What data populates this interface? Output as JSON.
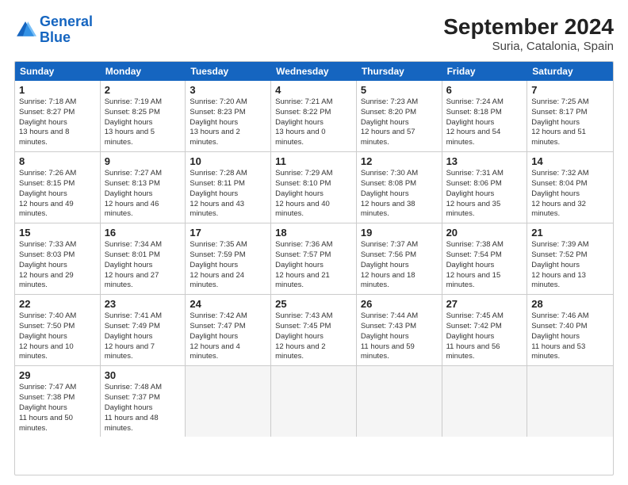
{
  "logo": {
    "text_general": "General",
    "text_blue": "Blue"
  },
  "header": {
    "title": "September 2024",
    "subtitle": "Suria, Catalonia, Spain"
  },
  "days_of_week": [
    "Sunday",
    "Monday",
    "Tuesday",
    "Wednesday",
    "Thursday",
    "Friday",
    "Saturday"
  ],
  "weeks": [
    [
      {
        "day": 1,
        "sunrise": "7:18 AM",
        "sunset": "8:27 PM",
        "daylight": "13 hours and 8 minutes."
      },
      {
        "day": 2,
        "sunrise": "7:19 AM",
        "sunset": "8:25 PM",
        "daylight": "13 hours and 5 minutes."
      },
      {
        "day": 3,
        "sunrise": "7:20 AM",
        "sunset": "8:23 PM",
        "daylight": "13 hours and 2 minutes."
      },
      {
        "day": 4,
        "sunrise": "7:21 AM",
        "sunset": "8:22 PM",
        "daylight": "13 hours and 0 minutes."
      },
      {
        "day": 5,
        "sunrise": "7:23 AM",
        "sunset": "8:20 PM",
        "daylight": "12 hours and 57 minutes."
      },
      {
        "day": 6,
        "sunrise": "7:24 AM",
        "sunset": "8:18 PM",
        "daylight": "12 hours and 54 minutes."
      },
      {
        "day": 7,
        "sunrise": "7:25 AM",
        "sunset": "8:17 PM",
        "daylight": "12 hours and 51 minutes."
      }
    ],
    [
      {
        "day": 8,
        "sunrise": "7:26 AM",
        "sunset": "8:15 PM",
        "daylight": "12 hours and 49 minutes."
      },
      {
        "day": 9,
        "sunrise": "7:27 AM",
        "sunset": "8:13 PM",
        "daylight": "12 hours and 46 minutes."
      },
      {
        "day": 10,
        "sunrise": "7:28 AM",
        "sunset": "8:11 PM",
        "daylight": "12 hours and 43 minutes."
      },
      {
        "day": 11,
        "sunrise": "7:29 AM",
        "sunset": "8:10 PM",
        "daylight": "12 hours and 40 minutes."
      },
      {
        "day": 12,
        "sunrise": "7:30 AM",
        "sunset": "8:08 PM",
        "daylight": "12 hours and 38 minutes."
      },
      {
        "day": 13,
        "sunrise": "7:31 AM",
        "sunset": "8:06 PM",
        "daylight": "12 hours and 35 minutes."
      },
      {
        "day": 14,
        "sunrise": "7:32 AM",
        "sunset": "8:04 PM",
        "daylight": "12 hours and 32 minutes."
      }
    ],
    [
      {
        "day": 15,
        "sunrise": "7:33 AM",
        "sunset": "8:03 PM",
        "daylight": "12 hours and 29 minutes."
      },
      {
        "day": 16,
        "sunrise": "7:34 AM",
        "sunset": "8:01 PM",
        "daylight": "12 hours and 27 minutes."
      },
      {
        "day": 17,
        "sunrise": "7:35 AM",
        "sunset": "7:59 PM",
        "daylight": "12 hours and 24 minutes."
      },
      {
        "day": 18,
        "sunrise": "7:36 AM",
        "sunset": "7:57 PM",
        "daylight": "12 hours and 21 minutes."
      },
      {
        "day": 19,
        "sunrise": "7:37 AM",
        "sunset": "7:56 PM",
        "daylight": "12 hours and 18 minutes."
      },
      {
        "day": 20,
        "sunrise": "7:38 AM",
        "sunset": "7:54 PM",
        "daylight": "12 hours and 15 minutes."
      },
      {
        "day": 21,
        "sunrise": "7:39 AM",
        "sunset": "7:52 PM",
        "daylight": "12 hours and 13 minutes."
      }
    ],
    [
      {
        "day": 22,
        "sunrise": "7:40 AM",
        "sunset": "7:50 PM",
        "daylight": "12 hours and 10 minutes."
      },
      {
        "day": 23,
        "sunrise": "7:41 AM",
        "sunset": "7:49 PM",
        "daylight": "12 hours and 7 minutes."
      },
      {
        "day": 24,
        "sunrise": "7:42 AM",
        "sunset": "7:47 PM",
        "daylight": "12 hours and 4 minutes."
      },
      {
        "day": 25,
        "sunrise": "7:43 AM",
        "sunset": "7:45 PM",
        "daylight": "12 hours and 2 minutes."
      },
      {
        "day": 26,
        "sunrise": "7:44 AM",
        "sunset": "7:43 PM",
        "daylight": "11 hours and 59 minutes."
      },
      {
        "day": 27,
        "sunrise": "7:45 AM",
        "sunset": "7:42 PM",
        "daylight": "11 hours and 56 minutes."
      },
      {
        "day": 28,
        "sunrise": "7:46 AM",
        "sunset": "7:40 PM",
        "daylight": "11 hours and 53 minutes."
      }
    ],
    [
      {
        "day": 29,
        "sunrise": "7:47 AM",
        "sunset": "7:38 PM",
        "daylight": "11 hours and 50 minutes."
      },
      {
        "day": 30,
        "sunrise": "7:48 AM",
        "sunset": "7:37 PM",
        "daylight": "11 hours and 48 minutes."
      },
      null,
      null,
      null,
      null,
      null
    ]
  ]
}
